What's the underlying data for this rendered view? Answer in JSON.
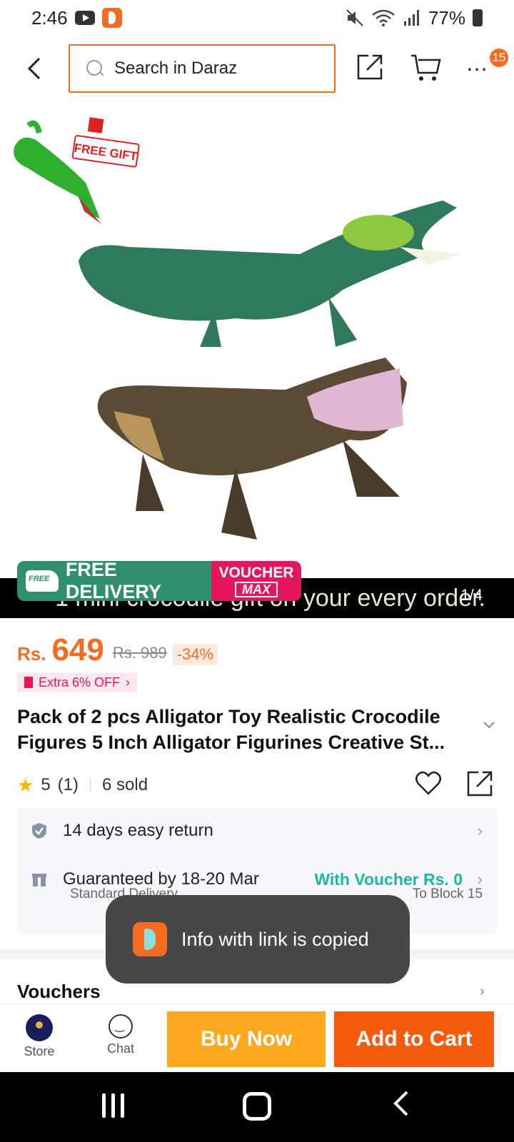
{
  "status_bar": {
    "time": "2:46",
    "battery": "77%"
  },
  "top_bar": {
    "search_placeholder": "Search in Daraz",
    "cart_badge": "15",
    "more_label": "…"
  },
  "hero": {
    "free_gift_label": "FREE GIFT",
    "caption_text": "1 mini crocodile gift on your every order.",
    "page_indicator": "1/4",
    "delivery_label": "FREE DELIVERY",
    "truck_label": "FREE",
    "voucher_label_1": "VOUCHER",
    "voucher_label_2": "MAX"
  },
  "price": {
    "currency": "Rs.",
    "value": "649",
    "original": "Rs. 989",
    "discount": "-34%",
    "extra_off": "Extra 6% OFF"
  },
  "product": {
    "title": "Pack of 2 pcs Alligator Toy Realistic Crocodile Figures 5 Inch Alligator Figurines Creative St...",
    "rating": "5",
    "rating_count": "(1)",
    "sold": "6 sold"
  },
  "service": {
    "return_label": "14 days easy return",
    "guarantee_label": "Guaranteed by 18-20 Mar",
    "voucher_label": "With Voucher Rs. 0",
    "delivery_type": "Standard Delivery",
    "delivery_to": "To Block 15"
  },
  "vouchers": {
    "title": "Vouchers"
  },
  "toast": {
    "message": "Info with link is copied"
  },
  "bottom_bar": {
    "store_label": "Store",
    "chat_label": "Chat",
    "buy_now_label": "Buy Now",
    "add_to_cart_label": "Add to Cart"
  },
  "colors": {
    "accent": "#f36c21",
    "buy_now": "#fca91f",
    "add_to_cart": "#f55b0c",
    "voucher": "#1fb7a0",
    "delivery": "#2f8f6e",
    "voucher_max": "#e5175a"
  }
}
